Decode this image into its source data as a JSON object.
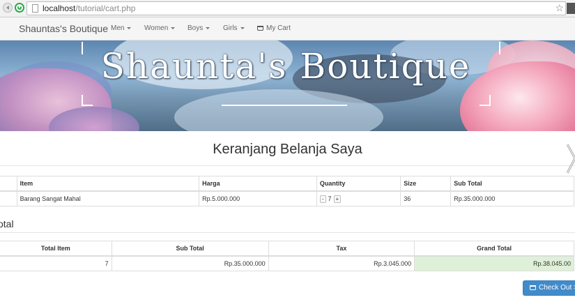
{
  "browser": {
    "url_host": "localhost",
    "url_path": "/tutorial/cart.php"
  },
  "navbar": {
    "brand": "Shauntas's Boutique",
    "items": [
      {
        "label": "Men"
      },
      {
        "label": "Women"
      },
      {
        "label": "Boys"
      },
      {
        "label": "Girls"
      }
    ],
    "cart_label": "My Cart"
  },
  "banner": {
    "title": "Shaunta's Boutique"
  },
  "page": {
    "title": "Keranjang Belanja Saya"
  },
  "cart": {
    "headers": [
      "Item",
      "Harga",
      "Quantity",
      "Size",
      "Sub Total"
    ],
    "rows": [
      {
        "item": "Barang Sangat Mahal",
        "price": "Rp.5.000.000",
        "quantity": "7",
        "qty_minus": "-",
        "qty_plus": "+",
        "size": "36",
        "subtotal": "Rp.35.000.000"
      }
    ]
  },
  "totals": {
    "heading": "otal",
    "headers": [
      "Total Item",
      "Sub Total",
      "Tax",
      "Grand Total"
    ],
    "values": {
      "total_item": "7",
      "sub_total": "Rp.35.000.000",
      "tax": "Rp.3.045.000",
      "grand_total": "Rp.38.045.00"
    }
  },
  "checkout": {
    "label": "Check Out >>"
  }
}
